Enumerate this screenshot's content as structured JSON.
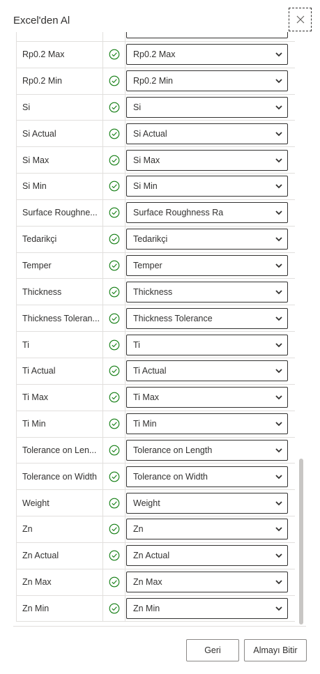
{
  "dialog": {
    "title": "Excel'den Al",
    "close_label": "×"
  },
  "colors": {
    "success": "#107c10",
    "border": "#e1dfdd",
    "text": "#323130"
  },
  "rows": [
    {
      "name": "",
      "mapped": ""
    },
    {
      "name": "Rp0.2 Max",
      "mapped": "Rp0.2 Max"
    },
    {
      "name": "Rp0.2 Min",
      "mapped": "Rp0.2 Min"
    },
    {
      "name": "Si",
      "mapped": "Si"
    },
    {
      "name": "Si Actual",
      "mapped": "Si Actual"
    },
    {
      "name": "Si Max",
      "mapped": "Si Max"
    },
    {
      "name": "Si Min",
      "mapped": "Si Min"
    },
    {
      "name": "Surface Roughne...",
      "mapped": "Surface Roughness Ra"
    },
    {
      "name": "Tedarikçi",
      "mapped": "Tedarikçi"
    },
    {
      "name": "Temper",
      "mapped": "Temper"
    },
    {
      "name": "Thickness",
      "mapped": "Thickness"
    },
    {
      "name": "Thickness Toleran...",
      "mapped": "Thickness Tolerance"
    },
    {
      "name": "Ti",
      "mapped": "Ti"
    },
    {
      "name": "Ti Actual",
      "mapped": "Ti Actual"
    },
    {
      "name": "Ti Max",
      "mapped": "Ti Max"
    },
    {
      "name": "Ti Min",
      "mapped": "Ti Min"
    },
    {
      "name": "Tolerance on Len...",
      "mapped": "Tolerance on Length"
    },
    {
      "name": "Tolerance on Width",
      "mapped": "Tolerance on Width"
    },
    {
      "name": "Weight",
      "mapped": "Weight"
    },
    {
      "name": "Zn",
      "mapped": "Zn"
    },
    {
      "name": "Zn Actual",
      "mapped": "Zn Actual"
    },
    {
      "name": "Zn Max",
      "mapped": "Zn Max"
    },
    {
      "name": "Zn Min",
      "mapped": "Zn Min"
    }
  ],
  "footer": {
    "back_label": "Geri",
    "finish_label": "Almayı Bitir"
  }
}
